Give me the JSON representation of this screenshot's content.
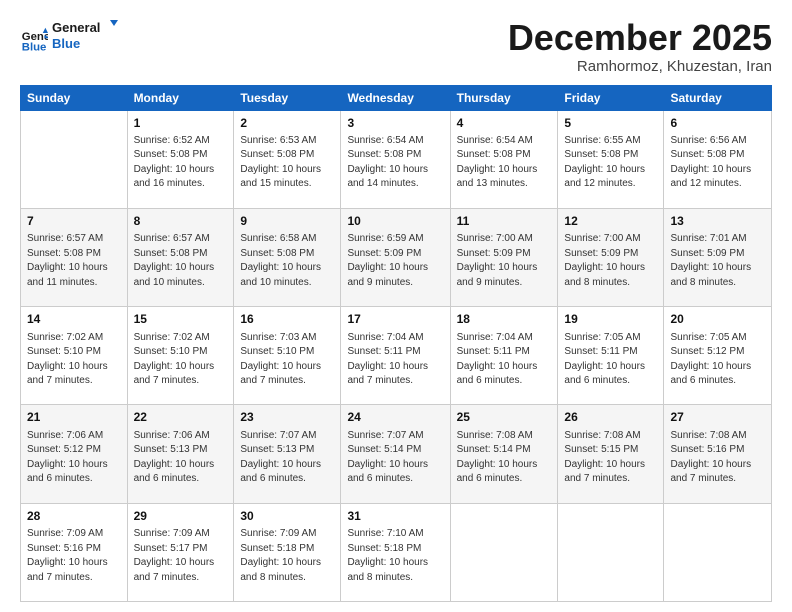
{
  "header": {
    "logo_line1": "General",
    "logo_line2": "Blue",
    "month": "December 2025",
    "location": "Ramhormoz, Khuzestan, Iran"
  },
  "days_of_week": [
    "Sunday",
    "Monday",
    "Tuesday",
    "Wednesday",
    "Thursday",
    "Friday",
    "Saturday"
  ],
  "weeks": [
    [
      {
        "day": "",
        "sunrise": "",
        "sunset": "",
        "daylight": ""
      },
      {
        "day": "1",
        "sunrise": "Sunrise: 6:52 AM",
        "sunset": "Sunset: 5:08 PM",
        "daylight": "Daylight: 10 hours and 16 minutes."
      },
      {
        "day": "2",
        "sunrise": "Sunrise: 6:53 AM",
        "sunset": "Sunset: 5:08 PM",
        "daylight": "Daylight: 10 hours and 15 minutes."
      },
      {
        "day": "3",
        "sunrise": "Sunrise: 6:54 AM",
        "sunset": "Sunset: 5:08 PM",
        "daylight": "Daylight: 10 hours and 14 minutes."
      },
      {
        "day": "4",
        "sunrise": "Sunrise: 6:54 AM",
        "sunset": "Sunset: 5:08 PM",
        "daylight": "Daylight: 10 hours and 13 minutes."
      },
      {
        "day": "5",
        "sunrise": "Sunrise: 6:55 AM",
        "sunset": "Sunset: 5:08 PM",
        "daylight": "Daylight: 10 hours and 12 minutes."
      },
      {
        "day": "6",
        "sunrise": "Sunrise: 6:56 AM",
        "sunset": "Sunset: 5:08 PM",
        "daylight": "Daylight: 10 hours and 12 minutes."
      }
    ],
    [
      {
        "day": "7",
        "sunrise": "Sunrise: 6:57 AM",
        "sunset": "Sunset: 5:08 PM",
        "daylight": "Daylight: 10 hours and 11 minutes."
      },
      {
        "day": "8",
        "sunrise": "Sunrise: 6:57 AM",
        "sunset": "Sunset: 5:08 PM",
        "daylight": "Daylight: 10 hours and 10 minutes."
      },
      {
        "day": "9",
        "sunrise": "Sunrise: 6:58 AM",
        "sunset": "Sunset: 5:08 PM",
        "daylight": "Daylight: 10 hours and 10 minutes."
      },
      {
        "day": "10",
        "sunrise": "Sunrise: 6:59 AM",
        "sunset": "Sunset: 5:09 PM",
        "daylight": "Daylight: 10 hours and 9 minutes."
      },
      {
        "day": "11",
        "sunrise": "Sunrise: 7:00 AM",
        "sunset": "Sunset: 5:09 PM",
        "daylight": "Daylight: 10 hours and 9 minutes."
      },
      {
        "day": "12",
        "sunrise": "Sunrise: 7:00 AM",
        "sunset": "Sunset: 5:09 PM",
        "daylight": "Daylight: 10 hours and 8 minutes."
      },
      {
        "day": "13",
        "sunrise": "Sunrise: 7:01 AM",
        "sunset": "Sunset: 5:09 PM",
        "daylight": "Daylight: 10 hours and 8 minutes."
      }
    ],
    [
      {
        "day": "14",
        "sunrise": "Sunrise: 7:02 AM",
        "sunset": "Sunset: 5:10 PM",
        "daylight": "Daylight: 10 hours and 7 minutes."
      },
      {
        "day": "15",
        "sunrise": "Sunrise: 7:02 AM",
        "sunset": "Sunset: 5:10 PM",
        "daylight": "Daylight: 10 hours and 7 minutes."
      },
      {
        "day": "16",
        "sunrise": "Sunrise: 7:03 AM",
        "sunset": "Sunset: 5:10 PM",
        "daylight": "Daylight: 10 hours and 7 minutes."
      },
      {
        "day": "17",
        "sunrise": "Sunrise: 7:04 AM",
        "sunset": "Sunset: 5:11 PM",
        "daylight": "Daylight: 10 hours and 7 minutes."
      },
      {
        "day": "18",
        "sunrise": "Sunrise: 7:04 AM",
        "sunset": "Sunset: 5:11 PM",
        "daylight": "Daylight: 10 hours and 6 minutes."
      },
      {
        "day": "19",
        "sunrise": "Sunrise: 7:05 AM",
        "sunset": "Sunset: 5:11 PM",
        "daylight": "Daylight: 10 hours and 6 minutes."
      },
      {
        "day": "20",
        "sunrise": "Sunrise: 7:05 AM",
        "sunset": "Sunset: 5:12 PM",
        "daylight": "Daylight: 10 hours and 6 minutes."
      }
    ],
    [
      {
        "day": "21",
        "sunrise": "Sunrise: 7:06 AM",
        "sunset": "Sunset: 5:12 PM",
        "daylight": "Daylight: 10 hours and 6 minutes."
      },
      {
        "day": "22",
        "sunrise": "Sunrise: 7:06 AM",
        "sunset": "Sunset: 5:13 PM",
        "daylight": "Daylight: 10 hours and 6 minutes."
      },
      {
        "day": "23",
        "sunrise": "Sunrise: 7:07 AM",
        "sunset": "Sunset: 5:13 PM",
        "daylight": "Daylight: 10 hours and 6 minutes."
      },
      {
        "day": "24",
        "sunrise": "Sunrise: 7:07 AM",
        "sunset": "Sunset: 5:14 PM",
        "daylight": "Daylight: 10 hours and 6 minutes."
      },
      {
        "day": "25",
        "sunrise": "Sunrise: 7:08 AM",
        "sunset": "Sunset: 5:14 PM",
        "daylight": "Daylight: 10 hours and 6 minutes."
      },
      {
        "day": "26",
        "sunrise": "Sunrise: 7:08 AM",
        "sunset": "Sunset: 5:15 PM",
        "daylight": "Daylight: 10 hours and 7 minutes."
      },
      {
        "day": "27",
        "sunrise": "Sunrise: 7:08 AM",
        "sunset": "Sunset: 5:16 PM",
        "daylight": "Daylight: 10 hours and 7 minutes."
      }
    ],
    [
      {
        "day": "28",
        "sunrise": "Sunrise: 7:09 AM",
        "sunset": "Sunset: 5:16 PM",
        "daylight": "Daylight: 10 hours and 7 minutes."
      },
      {
        "day": "29",
        "sunrise": "Sunrise: 7:09 AM",
        "sunset": "Sunset: 5:17 PM",
        "daylight": "Daylight: 10 hours and 7 minutes."
      },
      {
        "day": "30",
        "sunrise": "Sunrise: 7:09 AM",
        "sunset": "Sunset: 5:18 PM",
        "daylight": "Daylight: 10 hours and 8 minutes."
      },
      {
        "day": "31",
        "sunrise": "Sunrise: 7:10 AM",
        "sunset": "Sunset: 5:18 PM",
        "daylight": "Daylight: 10 hours and 8 minutes."
      },
      {
        "day": "",
        "sunrise": "",
        "sunset": "",
        "daylight": ""
      },
      {
        "day": "",
        "sunrise": "",
        "sunset": "",
        "daylight": ""
      },
      {
        "day": "",
        "sunrise": "",
        "sunset": "",
        "daylight": ""
      }
    ]
  ]
}
